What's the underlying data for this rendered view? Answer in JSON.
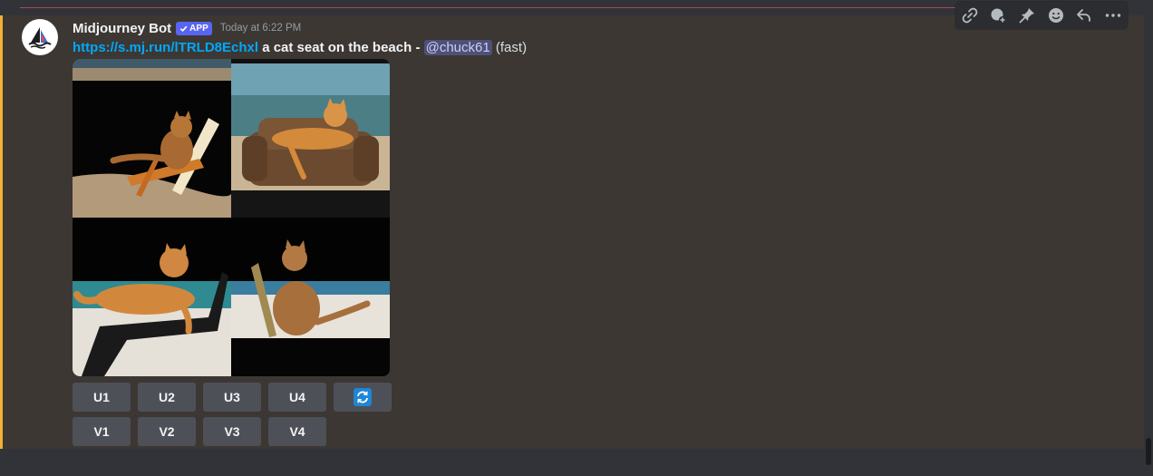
{
  "message": {
    "username": "Midjourney Bot",
    "badge": "APP",
    "timestamp": "Today at 6:22 PM",
    "link": "https://s.mj.run/lTRLD8Echxl",
    "prompt": "a cat seat on the beach",
    "separator": "-",
    "mention": "@chuck61",
    "speed": "(fast)"
  },
  "buttons": {
    "upscale": [
      "U1",
      "U2",
      "U3",
      "U4"
    ],
    "variation": [
      "V1",
      "V2",
      "V3",
      "V4"
    ],
    "reroll_icon": "refresh-icon"
  },
  "toolbar_icons": [
    "link-icon",
    "add-reaction-icon",
    "pin-icon",
    "emoji-icon",
    "reply-icon",
    "more-icon"
  ],
  "colors": {
    "accent": "#f0b232",
    "link": "#00a8fc",
    "badge": "#5865f2",
    "button": "#4e5058",
    "reroll": "#1e86d6"
  }
}
